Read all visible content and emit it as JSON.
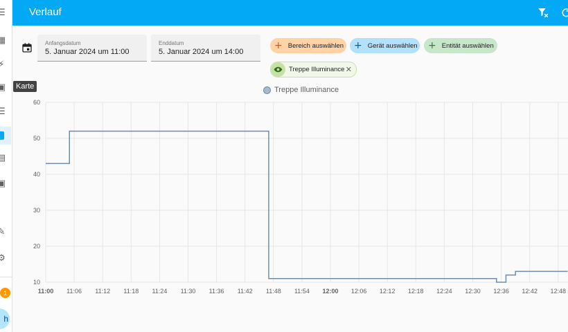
{
  "app": {
    "title": "Verlauf",
    "tooltip": "Karte"
  },
  "sidebar": {
    "notification_count": "1",
    "avatar_initial": "h"
  },
  "date_range": {
    "start_label": "Anfangsdatum",
    "start_value": "5. Januar 2024 um 11:00",
    "end_label": "Enddatum",
    "end_value": "5. Januar 2024 um 14:00"
  },
  "target_picker": {
    "area_label": "Bereich auswählen",
    "device_label": "Gerät auswählen",
    "entity_label": "Entität auswählen",
    "selected_entity": "Treppe Illuminance"
  },
  "colors": {
    "header": "#03a9f4",
    "line": "#6f8cab"
  },
  "chart_data": {
    "type": "line",
    "step": true,
    "legend": "top-center",
    "grid": true,
    "ylim": [
      10,
      60
    ],
    "yticks": [
      10,
      20,
      30,
      40,
      50,
      60
    ],
    "xticks": [
      "11:00",
      "11:06",
      "11:12",
      "11:18",
      "11:24",
      "11:30",
      "11:36",
      "11:42",
      "11:48",
      "11:54",
      "12:00",
      "12:06",
      "12:12",
      "12:18",
      "12:24",
      "12:30",
      "12:36",
      "12:42",
      "12:48"
    ],
    "xticks_bold": [
      "11:00",
      "12:00"
    ],
    "series": [
      {
        "name": "Treppe Illuminance",
        "points": [
          {
            "x": "11:00",
            "y": 43
          },
          {
            "x": "11:05",
            "y": 52
          },
          {
            "x": "11:47",
            "y": 11
          },
          {
            "x": "12:35",
            "y": 10
          },
          {
            "x": "12:37",
            "y": 12
          },
          {
            "x": "12:39",
            "y": 13
          },
          {
            "x": "12:50",
            "y": 13
          }
        ]
      }
    ]
  }
}
